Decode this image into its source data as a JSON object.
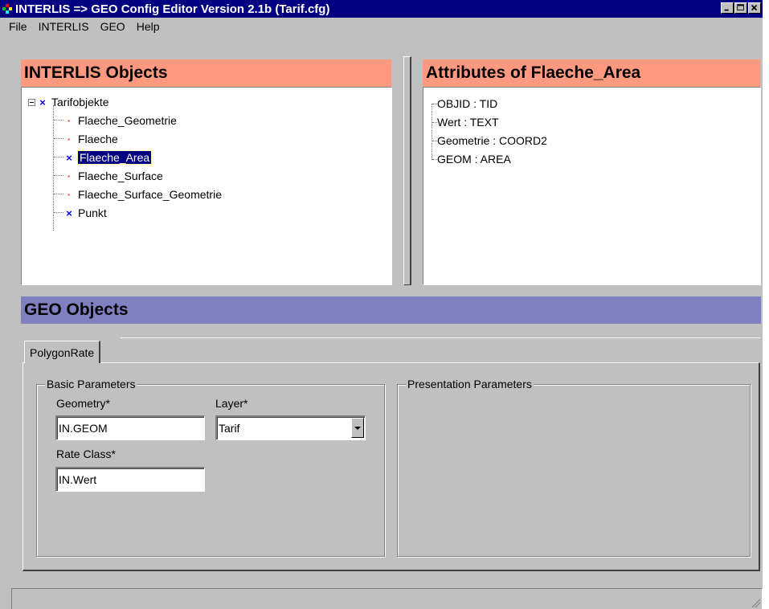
{
  "window": {
    "title": "INTERLIS => GEO Config Editor Version 2.1b (Tarif.cfg)",
    "controls": [
      "minimize",
      "maximize",
      "close"
    ]
  },
  "menu": {
    "items": [
      "File",
      "INTERLIS",
      "GEO",
      "Help"
    ]
  },
  "interlis_pane": {
    "title": "INTERLIS Objects",
    "tree": {
      "root": {
        "label": "Tarifobjekte",
        "icon": "x-icon",
        "expanded": true
      },
      "children": [
        {
          "label": "Flaeche_Geometrie",
          "icon": "dot-icon"
        },
        {
          "label": "Flaeche",
          "icon": "dot-icon"
        },
        {
          "label": "Flaeche_Area",
          "icon": "x-icon",
          "selected": true
        },
        {
          "label": "Flaeche_Surface",
          "icon": "dot-icon"
        },
        {
          "label": "Flaeche_Surface_Geometrie",
          "icon": "dot-icon"
        },
        {
          "label": "Punkt",
          "icon": "x-icon"
        }
      ]
    }
  },
  "attributes_pane": {
    "title": "Attributes of Flaeche_Area",
    "items": [
      "OBJID : TID",
      "Wert : TEXT",
      "Geometrie : COORD2",
      "GEOM : AREA"
    ]
  },
  "geo_pane": {
    "title": "GEO Objects",
    "tabs": [
      {
        "label": "PolygonRate",
        "active": true
      }
    ],
    "basic": {
      "legend": "Basic Parameters",
      "geometry_label": "Geometry*",
      "geometry_value": "IN.GEOM",
      "layer_label": "Layer*",
      "layer_value": "Tarif",
      "rate_class_label": "Rate Class*",
      "rate_class_value": "IN.Wert"
    },
    "presentation": {
      "legend": "Presentation Parameters"
    }
  },
  "colors": {
    "titlebar": "#000080",
    "interlis_header": "#ff9a80",
    "geo_header": "#8080c0",
    "selection": "#000080",
    "x_icon": "#0000ff",
    "dot_icon": "#ff4020"
  }
}
